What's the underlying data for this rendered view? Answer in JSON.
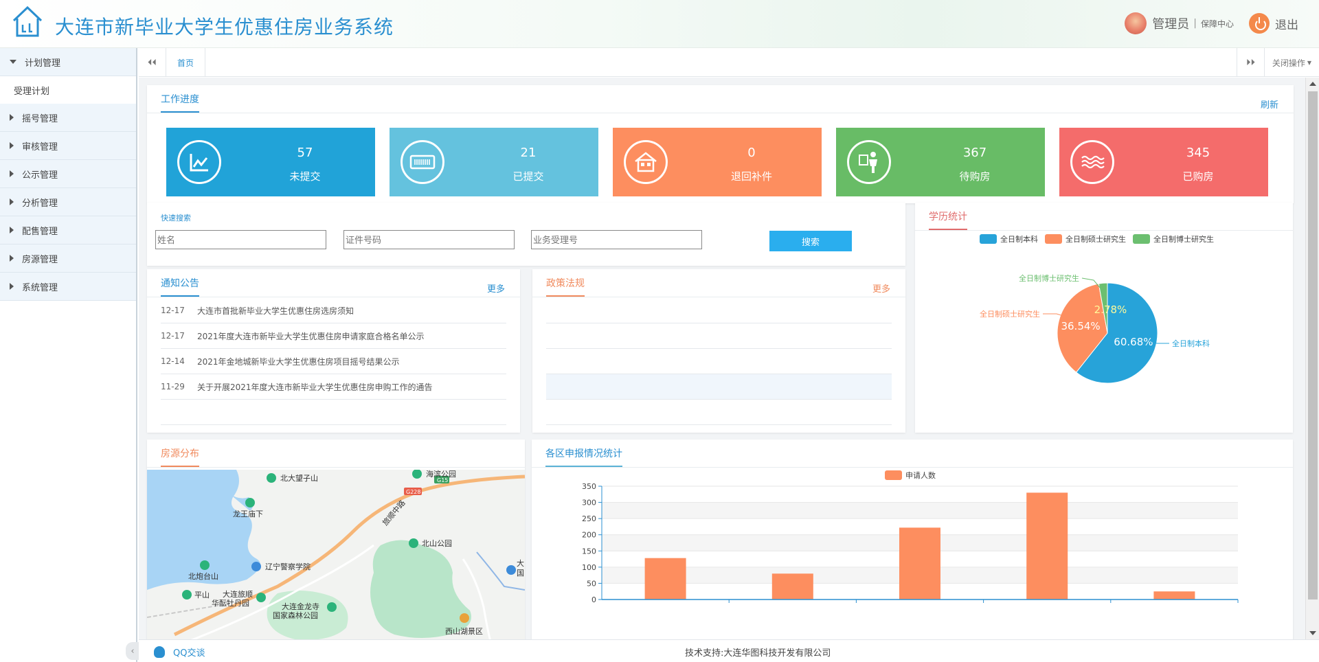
{
  "header": {
    "title": "大连市新毕业大学生优惠住房业务系统",
    "user_name": "管理员",
    "separator": "|",
    "center_link": "保障中心",
    "logout_label": "退出"
  },
  "sidebar": {
    "items": [
      {
        "label": "计划管理",
        "expanded": true
      },
      {
        "label": "摇号管理",
        "expanded": false
      },
      {
        "label": "审核管理",
        "expanded": false
      },
      {
        "label": "公示管理",
        "expanded": false
      },
      {
        "label": "分析管理",
        "expanded": false
      },
      {
        "label": "配售管理",
        "expanded": false
      },
      {
        "label": "房源管理",
        "expanded": false
      },
      {
        "label": "系统管理",
        "expanded": false
      }
    ],
    "sub_items": [
      {
        "label": "受理计划"
      }
    ]
  },
  "tabbar": {
    "home_tab": "首页",
    "close_ops": "关闭操作",
    "left_arrow": "⏴⏴",
    "right_arrow": "⏵⏵"
  },
  "progress": {
    "title": "工作进度",
    "refresh_label": "刷新",
    "cards": [
      {
        "value": "57",
        "label": "未提交",
        "color": "#21a3d8",
        "icon": "chart-line-icon"
      },
      {
        "value": "21",
        "label": "已提交",
        "color": "#64c2de",
        "icon": "barcode-icon"
      },
      {
        "value": "0",
        "label": "退回补件",
        "color": "#fd8e5f",
        "icon": "house-icon"
      },
      {
        "value": "367",
        "label": "待购房",
        "color": "#68bc66",
        "icon": "person-board-icon"
      },
      {
        "value": "345",
        "label": "已购房",
        "color": "#f46c6b",
        "icon": "waves-icon"
      }
    ]
  },
  "search": {
    "label": "快速搜索",
    "name_placeholder": "姓名",
    "id_placeholder": "证件号码",
    "biz_placeholder": "业务受理号",
    "button_label": "搜索"
  },
  "notice": {
    "title": "通知公告",
    "more_label": "更多",
    "items": [
      {
        "date": "12-17",
        "text": "大连市首批新毕业大学生优惠住房选房须知"
      },
      {
        "date": "12-17",
        "text": "2021年度大连市新毕业大学生优惠住房申请家庭合格名单公示"
      },
      {
        "date": "12-14",
        "text": "2021年金地城新毕业大学生优惠住房项目摇号结果公示"
      },
      {
        "date": "11-29",
        "text": "关于开展2021年度大连市新毕业大学生优惠住房申购工作的通告"
      }
    ]
  },
  "policy": {
    "title": "政策法规",
    "more_label": "更多"
  },
  "education": {
    "title": "学历统计",
    "chart_data": {
      "type": "pie",
      "slices": [
        {
          "name": "全日制本科",
          "value": 60.68,
          "label": "60.68%",
          "color": "#27a3d9"
        },
        {
          "name": "全日制硕士研究生",
          "value": 36.54,
          "label": "36.54%",
          "color": "#fd8e5f"
        },
        {
          "name": "全日制博士研究生",
          "value": 2.78,
          "label": "2.78%",
          "color": "#6cbf70"
        }
      ],
      "legend": "top"
    }
  },
  "housing_map": {
    "title": "房源分布",
    "labels": {
      "beidawangzishan": "北大望子山",
      "longwangmiaoxia": "龙王庙下",
      "haibingongyuan": "海滨公园",
      "beishangongyuan": "北山公园",
      "liaoningjingcha": "辽宁警察学院",
      "beipaotaishan": "北炮台山",
      "pingshan": "平山",
      "dalianlvshun": "大连旅顺",
      "huabomudanyuan": "华酝牡丹园",
      "jinlongsi": "大连金龙寺",
      "guojiasenlin": "国家森林公园",
      "xishanhu": "西山湖景区",
      "road_g15": "G15",
      "road_g228": "G228",
      "road_name": "旅顺中路",
      "edge_text_1": "大",
      "edge_text_2": "国"
    }
  },
  "district_stats": {
    "title": "各区申报情况统计",
    "chart_data": {
      "type": "bar",
      "series": [
        {
          "name": "申请人数",
          "values": [
            128,
            80,
            222,
            330,
            25
          ],
          "color": "#fd8e5f"
        }
      ],
      "ylim": [
        0,
        350
      ],
      "yticks": [
        0,
        50,
        100,
        150,
        200,
        250,
        300,
        350
      ],
      "legend": "top"
    }
  },
  "footer": {
    "qq_label": "QQ交谈",
    "tech_support": "技术支持:大连华图科技开发有限公司"
  }
}
